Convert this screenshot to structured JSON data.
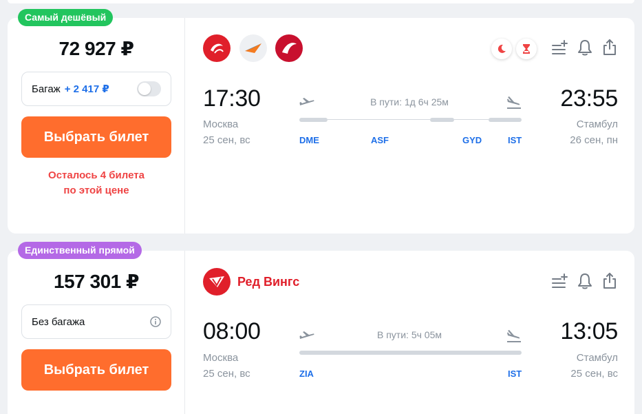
{
  "offers": [
    {
      "badge": "Самый дешёвый",
      "price": "72 927 ₽",
      "baggage_label": "Багаж",
      "baggage_extra": "+ 2 417 ₽",
      "buy_label": "Выбрать билет",
      "warning_line1": "Осталось 4 билета",
      "warning_line2": "по этой цене",
      "depart_time": "17:30",
      "depart_city": "Москва",
      "depart_date": "25 сен, вс",
      "arrive_time": "23:55",
      "arrive_city": "Стамбул",
      "arrive_date": "26 сен, пн",
      "duration": "В пути: 1д 6ч 25м",
      "codes": [
        "DME",
        "ASF",
        "GYD",
        "IST"
      ]
    },
    {
      "badge": "Единственный прямой",
      "price": "157 301 ₽",
      "baggage_label": "Без багажа",
      "buy_label": "Выбрать билет",
      "airline": "Ред Вингс",
      "depart_time": "08:00",
      "depart_city": "Москва",
      "depart_date": "25 сен, вс",
      "arrive_time": "13:05",
      "arrive_city": "Стамбул",
      "arrive_date": "25 сен, вс",
      "duration": "В пути: 5ч 05м",
      "codes": [
        "ZIA",
        "IST"
      ]
    }
  ],
  "colors": {
    "accent_orange": "#ff6d2d",
    "badge_green": "#22c55e",
    "badge_purple": "#b469e6",
    "link_blue": "#1e6fe8",
    "warning_red": "#ef4444",
    "red_wings": "#e01f2a"
  }
}
